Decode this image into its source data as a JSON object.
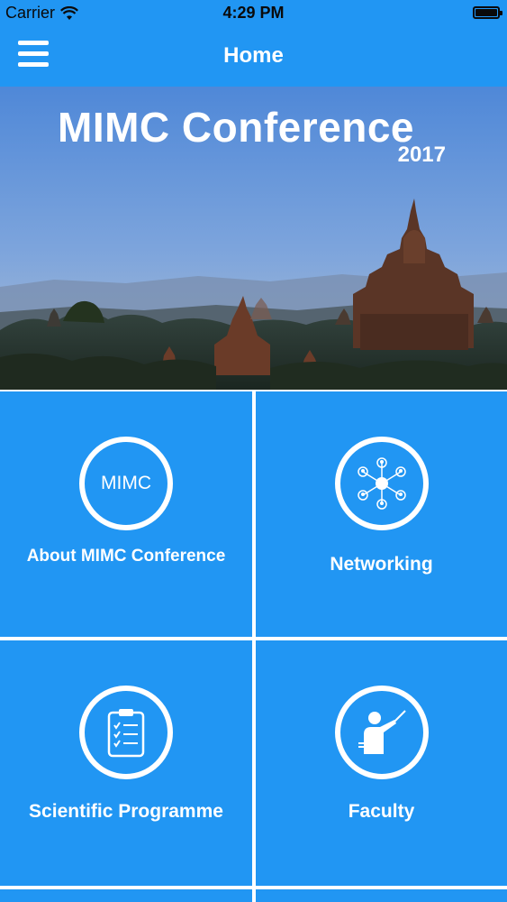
{
  "status": {
    "carrier": "Carrier",
    "time": "4:29 PM"
  },
  "nav": {
    "title": "Home"
  },
  "banner": {
    "title": "MIMC Conference",
    "year": "2017"
  },
  "tiles": [
    {
      "label": "About MIMC Conference",
      "icon_text": "MIMC",
      "icon": "mimc-logo-icon"
    },
    {
      "label": "Networking",
      "icon": "network-people-icon"
    },
    {
      "label": "Scientific Programme",
      "icon": "clipboard-checklist-icon"
    },
    {
      "label": "Faculty",
      "icon": "teacher-pointer-icon"
    }
  ],
  "colors": {
    "primary": "#2196f3",
    "divider": "#ffffff",
    "text": "#ffffff"
  }
}
